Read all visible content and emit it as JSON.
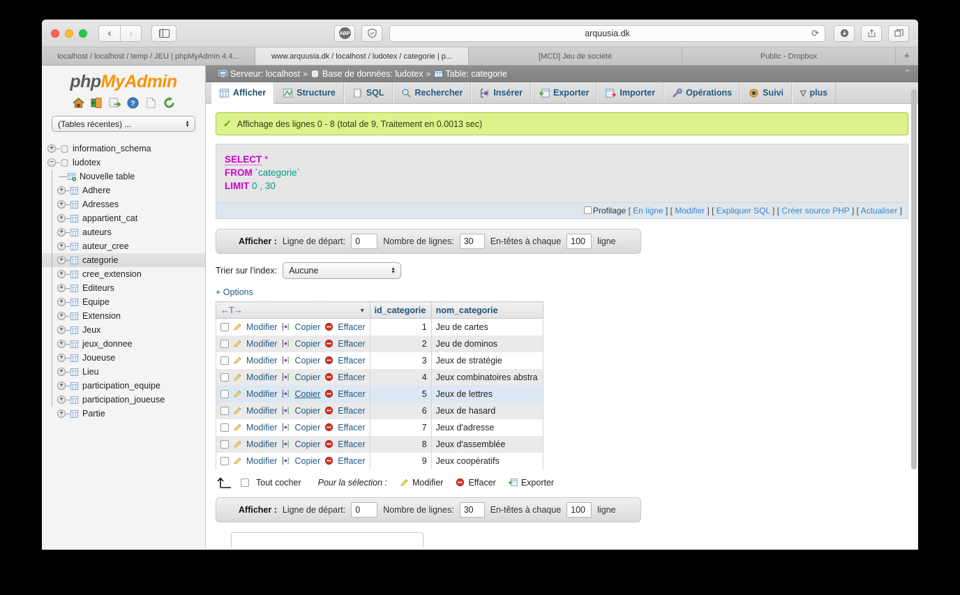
{
  "browser": {
    "url": "arquusia.dk",
    "tabs": [
      {
        "title": "localhost / localhost / temp / JEU | phpMyAdmin 4.4...",
        "active": false
      },
      {
        "title": "www.arquusia.dk / localhost / ludotex / categorie | p...",
        "active": true
      },
      {
        "title": "[MCD] Jeu de société",
        "active": false
      },
      {
        "title": "Public - Dropbox",
        "active": false
      }
    ],
    "new_tab_label": "+",
    "back_label": "‹",
    "forward_label": "›",
    "abp_label": "ABP",
    "reload_label": "⟳"
  },
  "sidebar": {
    "logo_php": "php",
    "logo_my": "MyAdmin",
    "icons": [
      "home-icon",
      "logout-icon",
      "db-export-icon",
      "help-icon",
      "docs-icon",
      "reload-icon"
    ],
    "recent_select": "(Tables récentes) ...",
    "tree": [
      {
        "label": "information_schema",
        "type": "db",
        "expander": "+",
        "selected": false
      },
      {
        "label": "ludotex",
        "type": "db",
        "expander": "−",
        "selected": false
      },
      {
        "label": "Nouvelle table",
        "type": "new",
        "expander": "",
        "selected": false
      },
      {
        "label": "Adhere",
        "type": "table",
        "expander": "+",
        "selected": false
      },
      {
        "label": "Adresses",
        "type": "table",
        "expander": "+",
        "selected": false
      },
      {
        "label": "appartient_cat",
        "type": "table",
        "expander": "+",
        "selected": false
      },
      {
        "label": "auteurs",
        "type": "table",
        "expander": "+",
        "selected": false
      },
      {
        "label": "auteur_cree",
        "type": "table",
        "expander": "+",
        "selected": false
      },
      {
        "label": "categorie",
        "type": "table",
        "expander": "+",
        "selected": true
      },
      {
        "label": "cree_extension",
        "type": "table",
        "expander": "+",
        "selected": false
      },
      {
        "label": "Editeurs",
        "type": "table",
        "expander": "+",
        "selected": false
      },
      {
        "label": "Equipe",
        "type": "table",
        "expander": "+",
        "selected": false
      },
      {
        "label": "Extension",
        "type": "table",
        "expander": "+",
        "selected": false
      },
      {
        "label": "Jeux",
        "type": "table",
        "expander": "+",
        "selected": false
      },
      {
        "label": "jeux_donnee",
        "type": "table",
        "expander": "+",
        "selected": false
      },
      {
        "label": "Joueuse",
        "type": "table",
        "expander": "+",
        "selected": false
      },
      {
        "label": "Lieu",
        "type": "table",
        "expander": "+",
        "selected": false
      },
      {
        "label": "participation_equipe",
        "type": "table",
        "expander": "+",
        "selected": false
      },
      {
        "label": "participation_joueuse",
        "type": "table",
        "expander": "+",
        "selected": false
      },
      {
        "label": "Partie",
        "type": "table",
        "expander": "+",
        "selected": false
      }
    ]
  },
  "breadcrumb": {
    "server_label": "Serveur: localhost",
    "db_label": "Base de données: ludotex",
    "table_label": "Table: categorie",
    "sep": "»",
    "collapse_glyph": "⌃"
  },
  "nav_tabs": [
    {
      "label": "Afficher",
      "icon": "table-icon",
      "active": true
    },
    {
      "label": "Structure",
      "icon": "structure-icon",
      "active": false
    },
    {
      "label": "SQL",
      "icon": "sql-icon",
      "active": false
    },
    {
      "label": "Rechercher",
      "icon": "search-icon",
      "active": false
    },
    {
      "label": "Insérer",
      "icon": "insert-icon",
      "active": false
    },
    {
      "label": "Exporter",
      "icon": "export-icon",
      "active": false
    },
    {
      "label": "Importer",
      "icon": "import-icon",
      "active": false
    },
    {
      "label": "Opérations",
      "icon": "wrench-icon",
      "active": false
    },
    {
      "label": "Suivi",
      "icon": "eye-icon",
      "active": false
    },
    {
      "label": "plus",
      "icon": "chevron-down-icon",
      "active": false
    }
  ],
  "status": {
    "message": "Affichage des lignes 0 - 8 (total de 9, Traitement en 0.0013 sec)"
  },
  "sql": {
    "kw_select": "SELECT",
    "star": "*",
    "kw_from": "FROM",
    "table_name": "categorie",
    "backtick": "`",
    "kw_limit": "LIMIT",
    "limit_start": "0",
    "comma": ",",
    "limit_count": "30",
    "profiling_label": "Profilage",
    "links": [
      "En ligne",
      "Modifier",
      "Expliquer SQL",
      "Créer source PHP",
      "Actualiser"
    ],
    "bracket_open": "[",
    "bracket_close": "]"
  },
  "display_bar": {
    "title": "Afficher :",
    "start_label": "Ligne de départ:",
    "start_value": "0",
    "rows_label": "Nombre de lignes:",
    "rows_value": "30",
    "headers_label": "En-têtes à chaque",
    "headers_value": "100",
    "line_label": "ligne"
  },
  "sort_index": {
    "label": "Trier sur l'index:",
    "value": "Aucune"
  },
  "options_link": "+ Options",
  "table": {
    "sort_glyph": "←T→",
    "caret": "▼",
    "columns": [
      "id_categorie",
      "nom_categorie"
    ],
    "action_labels": {
      "edit": "Modifier",
      "copy": "Copier",
      "delete": "Effacer"
    },
    "rows": [
      {
        "id": "1",
        "nom": "Jeu de cartes",
        "highlight": false
      },
      {
        "id": "2",
        "nom": "Jeu de dominos",
        "highlight": false
      },
      {
        "id": "3",
        "nom": "Jeux de stratégie",
        "highlight": false
      },
      {
        "id": "4",
        "nom": "Jeux combinatoires abstra",
        "highlight": false
      },
      {
        "id": "5",
        "nom": "Jeux de lettres",
        "highlight": true
      },
      {
        "id": "6",
        "nom": "Jeux de hasard",
        "highlight": false
      },
      {
        "id": "7",
        "nom": "Jeux d'adresse",
        "highlight": false
      },
      {
        "id": "8",
        "nom": "Jeux d'assemblée",
        "highlight": false
      },
      {
        "id": "9",
        "nom": "Jeux coopératifs",
        "highlight": false
      }
    ]
  },
  "selection_bar": {
    "check_all": "Tout cocher",
    "for_selection": "Pour la sélection :",
    "edit": "Modifier",
    "delete": "Effacer",
    "export": "Exporter"
  }
}
